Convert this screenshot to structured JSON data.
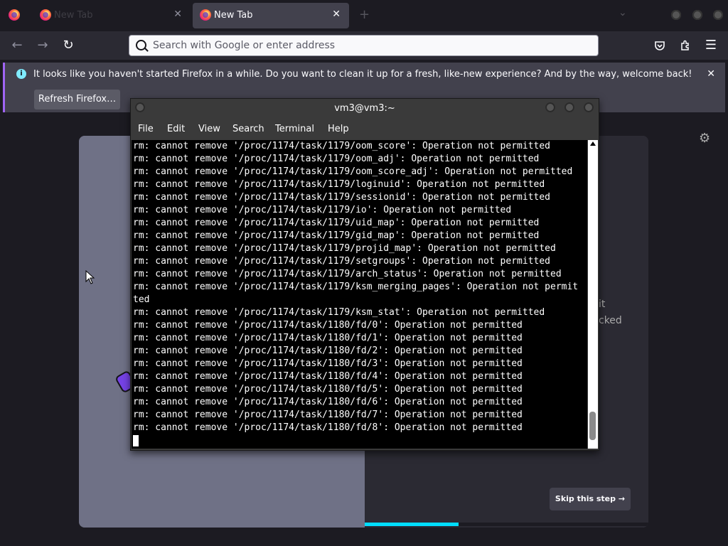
{
  "tabs": [
    {
      "title": "New Tab",
      "active": false
    },
    {
      "title": "New Tab",
      "active": true
    }
  ],
  "tab_close_glyph": "✕",
  "new_tab_glyph": "+",
  "urlbar": {
    "placeholder": "Search with Google or enter address"
  },
  "notification": {
    "message": "It looks like you haven't started Firefox in a while. Do you want to clean it up for a fresh, like-new experience? And by the way, welcome back!",
    "button": "Refresh Firefox…"
  },
  "page": {
    "fragment1": "it",
    "fragment2": "cked",
    "skip_label": "Skip this step →",
    "progress": 0.33
  },
  "terminal": {
    "title": "vm3@vm3:~",
    "menu": [
      "File",
      "Edit",
      "View",
      "Search",
      "Terminal",
      "Help"
    ],
    "lines": [
      "rm: cannot remove '/proc/1174/task/1179/oom_score': Operation not permitted",
      "rm: cannot remove '/proc/1174/task/1179/oom_adj': Operation not permitted",
      "rm: cannot remove '/proc/1174/task/1179/oom_score_adj': Operation not permitted",
      "rm: cannot remove '/proc/1174/task/1179/loginuid': Operation not permitted",
      "rm: cannot remove '/proc/1174/task/1179/sessionid': Operation not permitted",
      "rm: cannot remove '/proc/1174/task/1179/io': Operation not permitted",
      "rm: cannot remove '/proc/1174/task/1179/uid_map': Operation not permitted",
      "rm: cannot remove '/proc/1174/task/1179/gid_map': Operation not permitted",
      "rm: cannot remove '/proc/1174/task/1179/projid_map': Operation not permitted",
      "rm: cannot remove '/proc/1174/task/1179/setgroups': Operation not permitted",
      "rm: cannot remove '/proc/1174/task/1179/arch_status': Operation not permitted",
      "rm: cannot remove '/proc/1174/task/1179/ksm_merging_pages': Operation not permit",
      "ted",
      "rm: cannot remove '/proc/1174/task/1179/ksm_stat': Operation not permitted",
      "rm: cannot remove '/proc/1174/task/1180/fd/0': Operation not permitted",
      "rm: cannot remove '/proc/1174/task/1180/fd/1': Operation not permitted",
      "rm: cannot remove '/proc/1174/task/1180/fd/2': Operation not permitted",
      "rm: cannot remove '/proc/1174/task/1180/fd/3': Operation not permitted",
      "rm: cannot remove '/proc/1174/task/1180/fd/4': Operation not permitted",
      "rm: cannot remove '/proc/1174/task/1180/fd/5': Operation not permitted",
      "rm: cannot remove '/proc/1174/task/1180/fd/6': Operation not permitted",
      "rm: cannot remove '/proc/1174/task/1180/fd/7': Operation not permitted",
      "rm: cannot remove '/proc/1174/task/1180/fd/8': Operation not permitted"
    ]
  },
  "icons": {
    "back": "←",
    "forward": "→",
    "reload": "↻",
    "close": "✕",
    "pocket": "pocket-icon",
    "extensions": "puzzle-icon",
    "menu": "☰",
    "settings": "⚙"
  },
  "colors": {
    "accent": "#00ddff",
    "notification_border": "#a065f5",
    "terminal_bg": "#000000"
  }
}
